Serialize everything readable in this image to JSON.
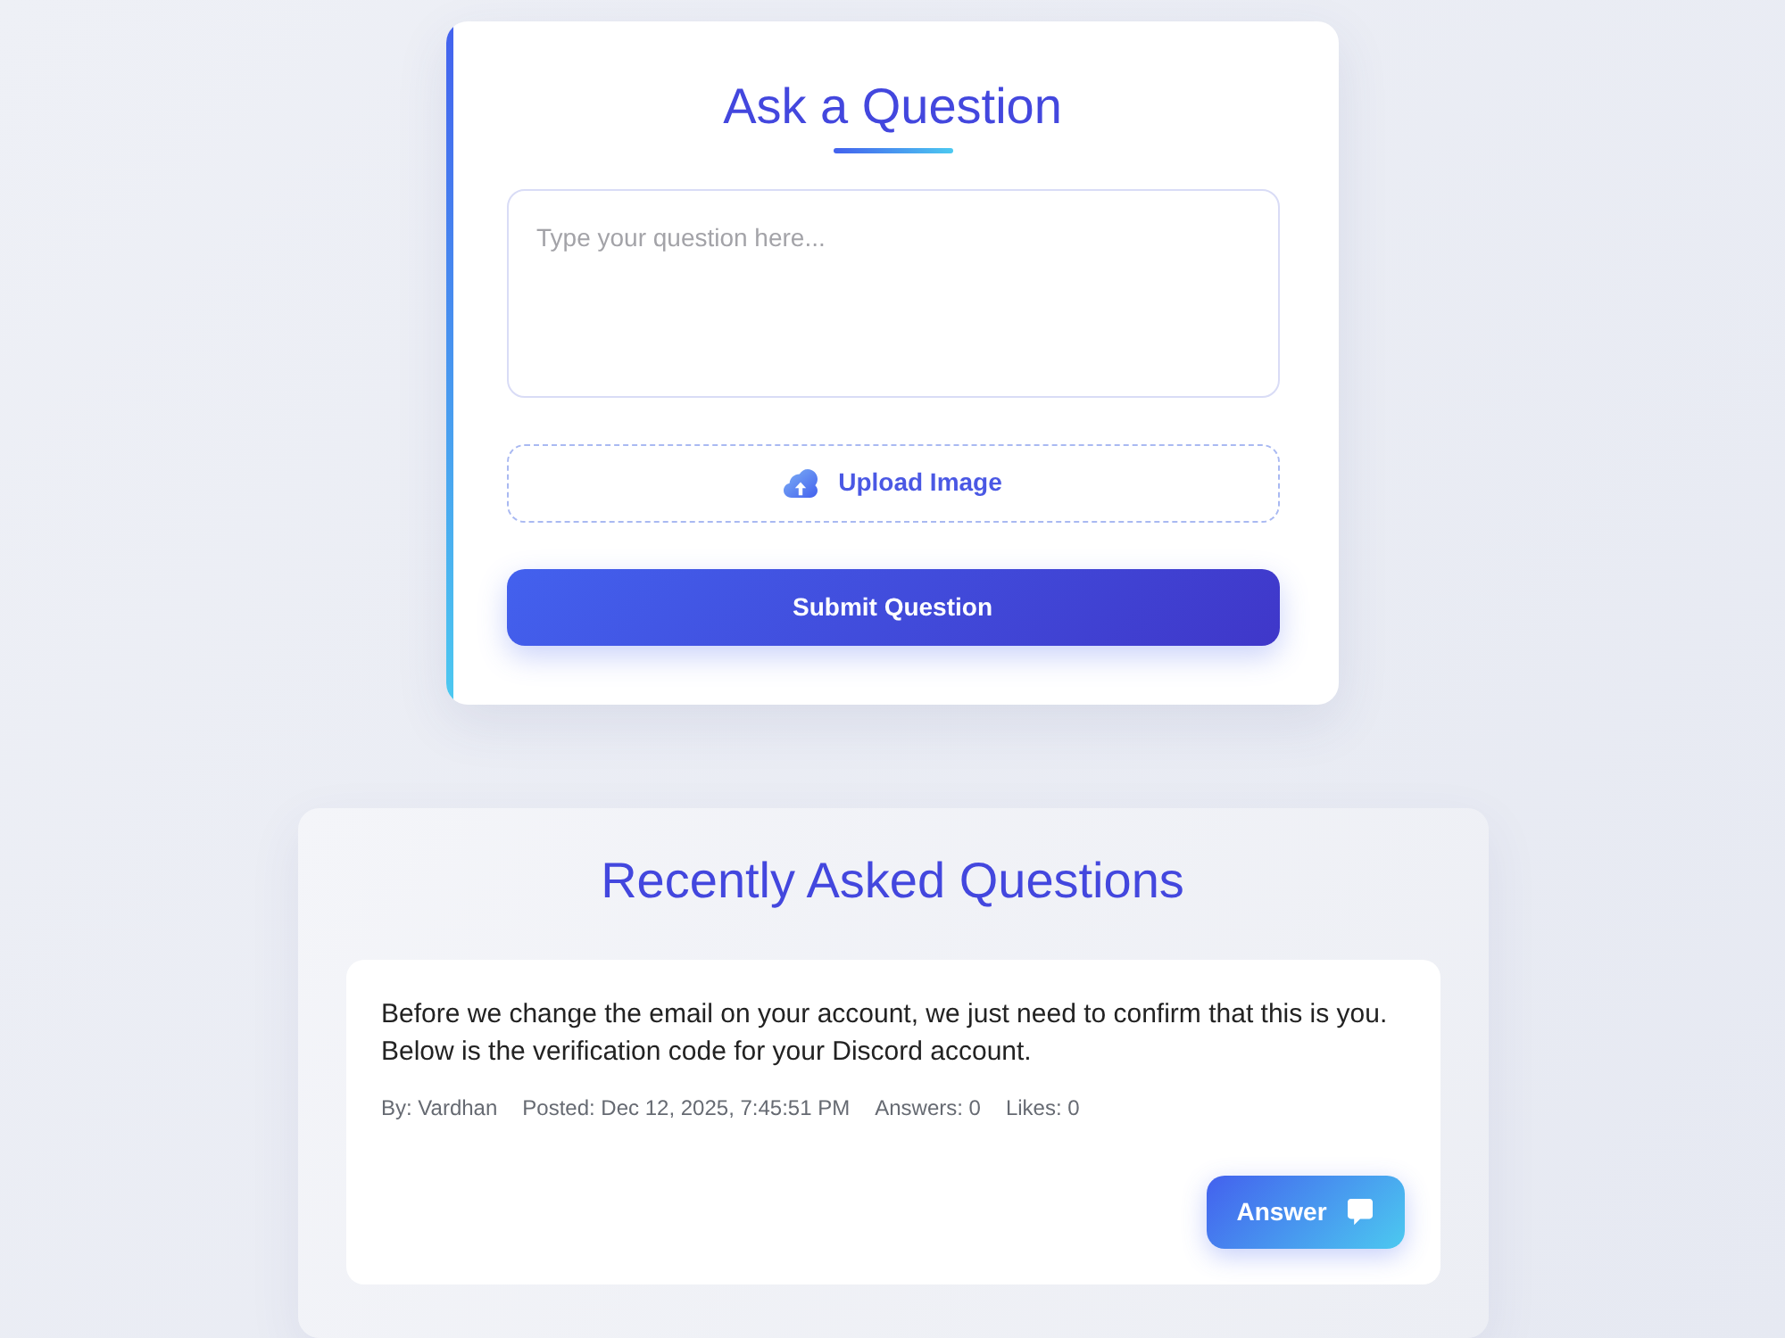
{
  "ask_form": {
    "title": "Ask a Question",
    "question_field": {
      "placeholder": "Type your question here..."
    },
    "upload_button": "Upload Image",
    "submit_button": "Submit Question"
  },
  "recent_questions": {
    "title": "Recently Asked Questions",
    "questions": [
      {
        "text": "Before we change the email on your account, we just need to confirm that this is you. Below is the verification code for your Discord account.",
        "author": "By: Vardhan",
        "posted": "Posted: Dec 12, 2025, 7:45:51 PM",
        "answers": "Answers: 0",
        "likes": "Likes: 0",
        "answer_button": "Answer"
      }
    ]
  }
}
